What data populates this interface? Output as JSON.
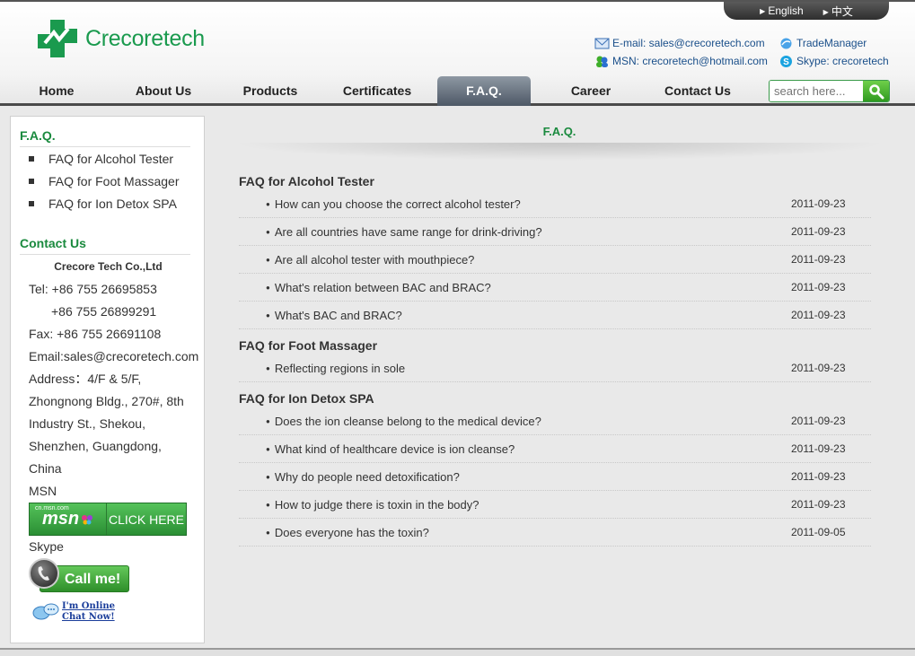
{
  "brand": {
    "name": "Crecoretech",
    "color": "#1a9a4e"
  },
  "languages": [
    "English",
    "中文"
  ],
  "header_contacts": {
    "email": "E-mail: sales@crecoretech.com",
    "msn": "MSN: crecoretech@hotmail.com",
    "trade_manager": "TradeManager",
    "skype": "Skype: crecoretech"
  },
  "nav": {
    "items": [
      "Home",
      "About Us",
      "Products",
      "Certificates",
      "F.A.Q.",
      "Career",
      "Contact Us"
    ],
    "active": "F.A.Q."
  },
  "search": {
    "placeholder": "search here..."
  },
  "sidebar": {
    "faq_heading": "F.A.Q.",
    "faq_links": [
      "FAQ for Alcohol Tester",
      "FAQ for Foot Massager",
      "FAQ for Ion Detox SPA"
    ],
    "contact_heading": "Contact Us",
    "company": "Crecore Tech Co.,Ltd",
    "tel1": "Tel: +86 755 26695853",
    "tel2": "+86 755 26899291",
    "fax": "Fax: +86 755 26691108",
    "email": "Email:sales@crecoretech.com",
    "address": [
      "Address：4/F & 5/F,",
      "Zhongnong Bldg., 270#, 8th",
      "Industry St., Shekou,",
      "Shenzhen, Guangdong,",
      "China"
    ],
    "msn_label": "MSN",
    "msn_site": "cn.msn.com",
    "msn_logo": "msn",
    "msn_button": "CLICK HERE",
    "skype_label": "Skype",
    "call_button": "Call me!",
    "online_line1": "I'm Online",
    "online_line2": "Chat Now!"
  },
  "main": {
    "title": "F.A.Q.",
    "sections": [
      {
        "title": "FAQ for Alcohol Tester",
        "items": [
          {
            "q": "How can you choose the correct alcohol tester?",
            "date": "2011-09-23"
          },
          {
            "q": "Are all countries have same range for drink-driving?",
            "date": "2011-09-23"
          },
          {
            "q": "Are all alcohol tester with mouthpiece?",
            "date": "2011-09-23"
          },
          {
            "q": "What's relation between BAC and BRAC?",
            "date": "2011-09-23"
          },
          {
            "q": "What's BAC and BRAC?",
            "date": "2011-09-23"
          }
        ]
      },
      {
        "title": "FAQ for Foot Massager",
        "items": [
          {
            "q": "Reflecting regions in sole",
            "date": "2011-09-23"
          }
        ]
      },
      {
        "title": "FAQ for Ion Detox SPA",
        "items": [
          {
            "q": "Does the ion cleanse belong to the medical device?",
            "date": "2011-09-23"
          },
          {
            "q": "What kind of healthcare device is ion cleanse?",
            "date": "2011-09-23"
          },
          {
            "q": "Why do people need detoxification?",
            "date": "2011-09-23"
          },
          {
            "q": "How to judge there is toxin in the body?",
            "date": "2011-09-23"
          },
          {
            "q": "Does everyone has the toxin?",
            "date": "2011-09-05"
          }
        ]
      }
    ]
  }
}
